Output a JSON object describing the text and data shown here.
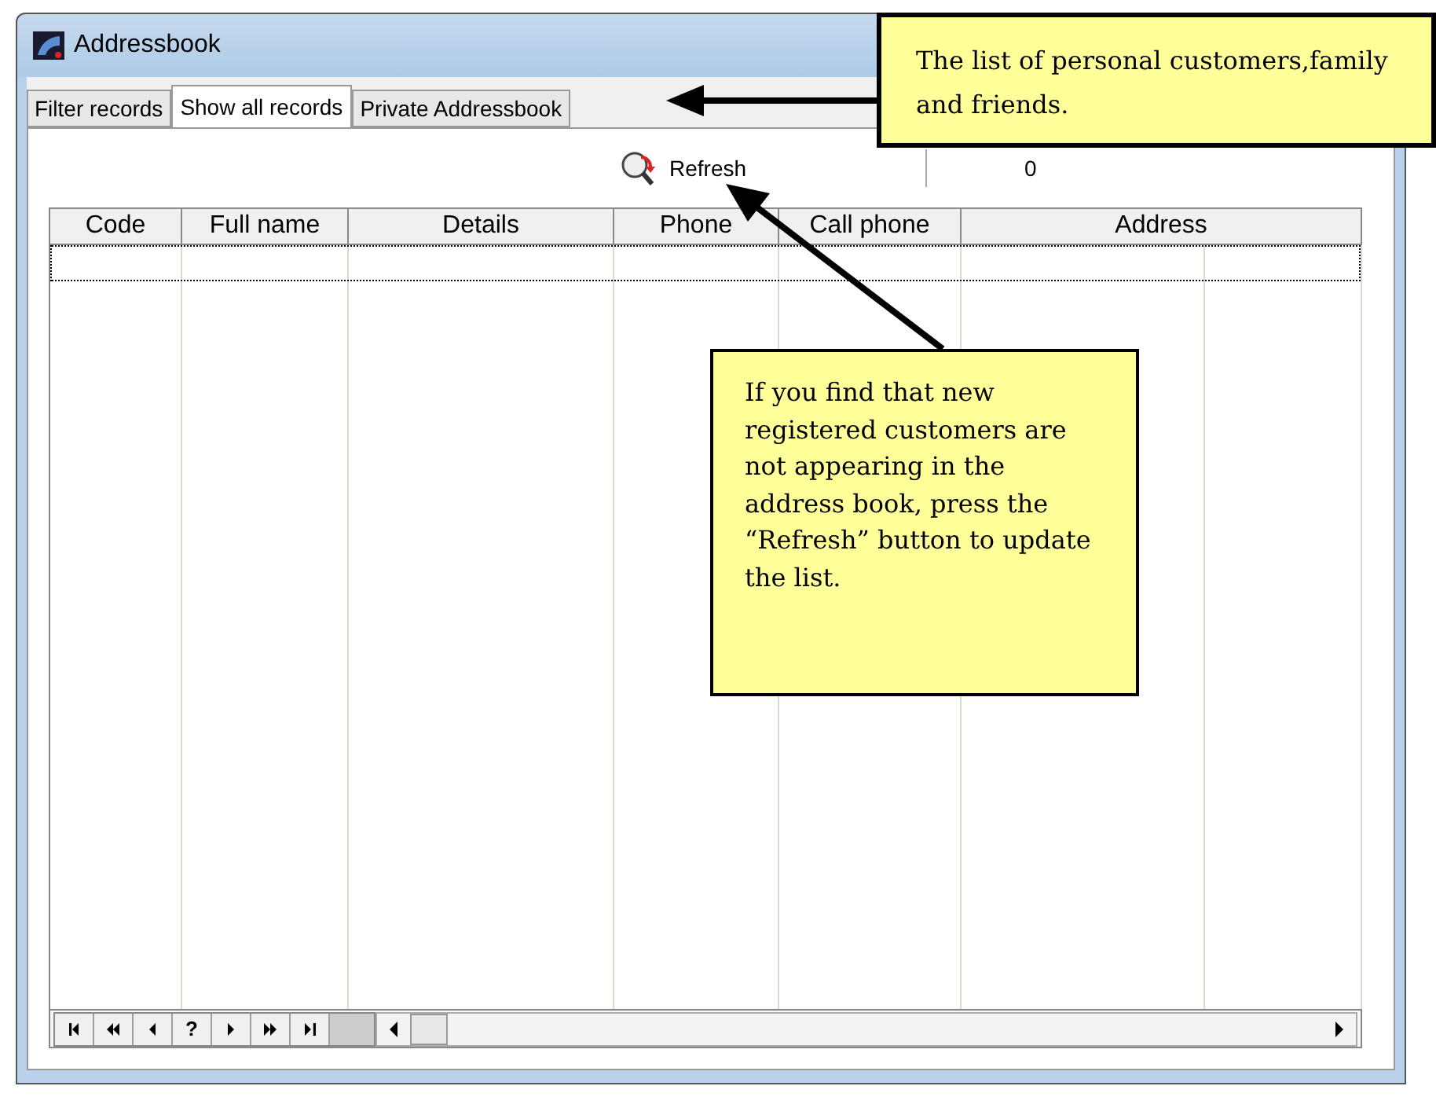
{
  "window": {
    "title": "Addressbook"
  },
  "tabs": [
    {
      "label": "Filter records",
      "selected": false
    },
    {
      "label": "Show all records",
      "selected": true
    },
    {
      "label": "Private Addressbook",
      "selected": false
    }
  ],
  "toolbar": {
    "refresh_label": "Refresh",
    "count": "0"
  },
  "table": {
    "columns": [
      "Code",
      "Full name",
      "Details",
      "Phone",
      "Call phone",
      "Address"
    ]
  },
  "navigator": {
    "search_label": "?"
  },
  "callouts": [
    {
      "text": "The list of personal customers,family and friends."
    },
    {
      "text": "If you find that new registered customers are not appearing in the address book, press the “Refresh” button to update the list."
    }
  ]
}
